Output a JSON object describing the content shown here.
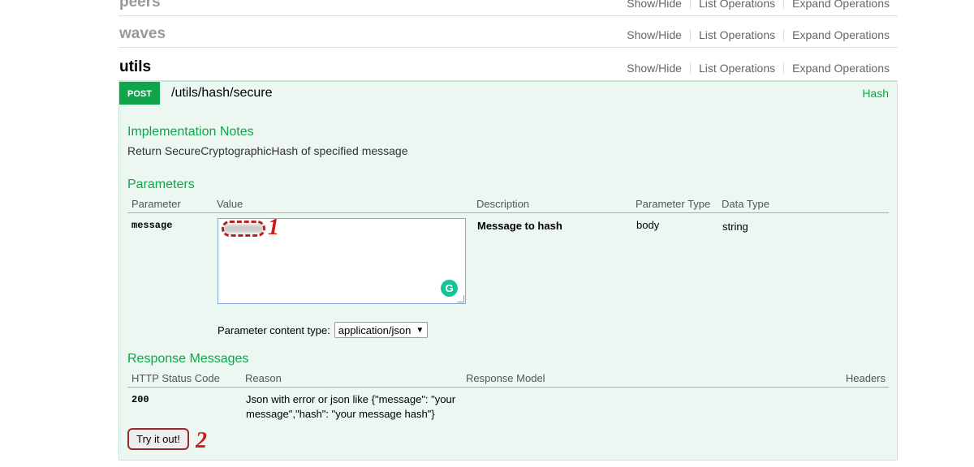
{
  "resources": [
    {
      "name": "peers"
    },
    {
      "name": "waves"
    },
    {
      "name": "utils"
    }
  ],
  "links": {
    "show_hide": "Show/Hide",
    "list_operations": "List Operations",
    "expand_operations": "Expand Operations"
  },
  "operation": {
    "method": "POST",
    "path": "/utils/hash/secure",
    "tag": "Hash",
    "notes_title": "Implementation Notes",
    "notes": "Return SecureCryptographicHash of specified message",
    "params_title": "Parameters",
    "params_headers": {
      "parameter": "Parameter",
      "value": "Value",
      "description": "Description",
      "param_type": "Parameter Type",
      "data_type": "Data Type"
    },
    "param": {
      "name": "message",
      "value": "",
      "description": "Message to hash",
      "param_type": "body",
      "data_type": "string"
    },
    "content_type_label": "Parameter content type:",
    "content_type_value": "application/json",
    "responses_title": "Response Messages",
    "responses_headers": {
      "code": "HTTP Status Code",
      "reason": "Reason",
      "model": "Response Model",
      "headers": "Headers"
    },
    "response": {
      "code": "200",
      "reason_line1": "Json with error or json like {\"message\": \"your",
      "reason_line2": "message\",\"hash\": \"your message hash\"}"
    },
    "try_button": "Try it out!"
  },
  "annotations": {
    "marker1": "1",
    "marker2": "2"
  },
  "colors": {
    "post_green": "#10a54a",
    "op_bg": "#ebf7f0",
    "marker_red": "#d01818"
  },
  "icons": {
    "grammarly": "grammarly-icon",
    "select": "caret-down-icon"
  }
}
